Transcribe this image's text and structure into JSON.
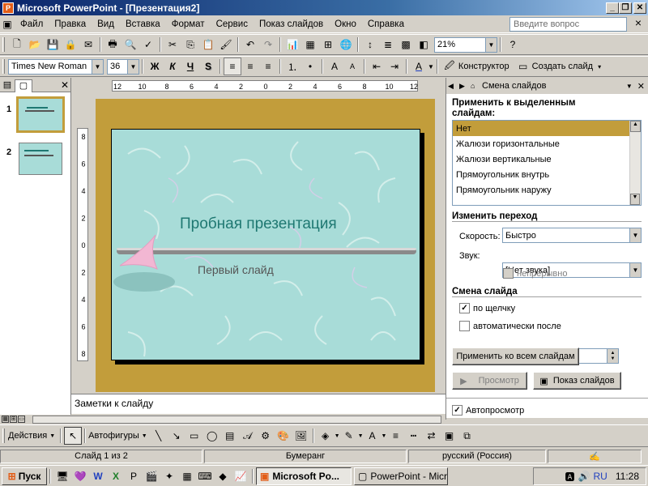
{
  "window": {
    "title": "Microsoft PowerPoint - [Презентация2]",
    "minimize": "_",
    "restore": "❐",
    "close": "✕"
  },
  "menu": {
    "items": [
      "Файл",
      "Правка",
      "Вид",
      "Вставка",
      "Формат",
      "Сервис",
      "Показ слайдов",
      "Окно",
      "Справка"
    ],
    "help_placeholder": "Введите вопрос",
    "doc_close": "×"
  },
  "standard_toolbar": {
    "zoom": "21%"
  },
  "format_toolbar": {
    "font": "Times New Roman",
    "size": "36",
    "bold": "Ж",
    "italic": "К",
    "underline": "Ч",
    "shadow": "S",
    "designer": "Конструктор",
    "new_slide": "Создать слайд"
  },
  "left_pane": {
    "slides": [
      {
        "number": "1",
        "selected": true
      },
      {
        "number": "2",
        "selected": false
      }
    ]
  },
  "slide": {
    "title": "Пробная презентация",
    "subtitle": "Первый слайд"
  },
  "ruler": {
    "h_ticks": [
      "12",
      "10",
      "8",
      "6",
      "4",
      "2",
      "0",
      "2",
      "4",
      "6",
      "8",
      "10",
      "12"
    ],
    "v_ticks": [
      "8",
      "6",
      "4",
      "2",
      "0",
      "2",
      "4",
      "6",
      "8"
    ]
  },
  "notes": {
    "placeholder": "Заметки к слайду"
  },
  "task_pane": {
    "title": "Смена слайдов",
    "apply_label": "Применить к выделенным слайдам:",
    "transitions": [
      "Нет",
      "Жалюзи горизонтальные",
      "Жалюзи вертикальные",
      "Прямоугольник внутрь",
      "Прямоугольник наружу"
    ],
    "selected_transition": "Нет",
    "modify_label": "Изменить переход",
    "speed_label": "Скорость:",
    "speed_value": "Быстро",
    "sound_label": "Звук:",
    "sound_value": "[Нет звука]",
    "loop_label": "непрерывно",
    "advance_label": "Смена слайда",
    "on_click_label": "по щелчку",
    "on_click_checked": true,
    "auto_label": "автоматически после",
    "auto_checked": false,
    "auto_value": "",
    "apply_all": "Применить ко всем слайдам",
    "preview": "Просмотр",
    "slideshow": "Показ слайдов",
    "autopreview_label": "Автопросмотр",
    "autopreview_checked": true
  },
  "draw_toolbar": {
    "actions": "Действия",
    "autoshapes": "Автофигуры"
  },
  "status_bar": {
    "slide_info": "Слайд 1 из 2",
    "design": "Бумеранг",
    "language": "русский (Россия)"
  },
  "taskbar": {
    "start": "Пуск",
    "buttons": [
      "Microsoft Po...",
      "PowerPoint - Micro..."
    ],
    "lang": "RU",
    "time": "11:28"
  },
  "colors": {
    "title_bar": "#0a246a",
    "slide_bg": "#a8dcd8",
    "work_area": "#c29d3b",
    "title_text": "#1f7872",
    "selection": "#c29d3b"
  }
}
